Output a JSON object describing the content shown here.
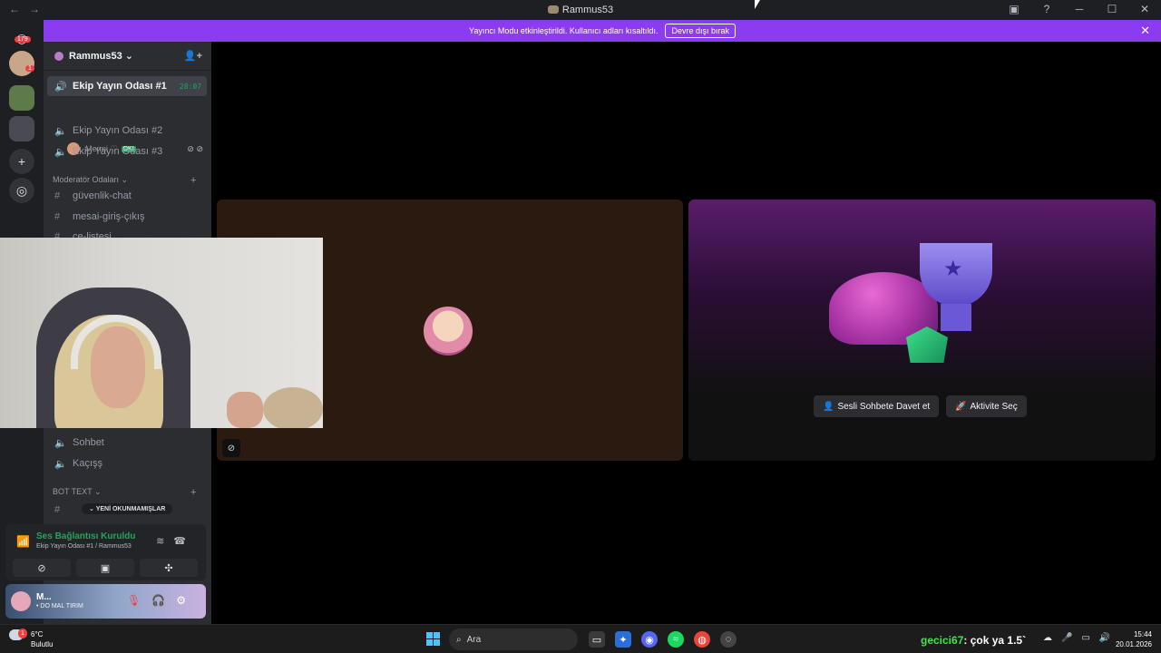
{
  "window": {
    "title": "Rammus53",
    "nav_back": "←",
    "nav_fwd": "→",
    "inbox_icon": "▣",
    "help_icon": "?",
    "min": "─",
    "max": "☐",
    "close": "✕"
  },
  "banner": {
    "text": "Yayıncı Modu etkinleştirildi. Kullanıcı adları kısaltıldı.",
    "button": "Devre dışı bırak",
    "close": "✕"
  },
  "guilds": {
    "badge_top": "179",
    "badge_user": "1"
  },
  "server": {
    "name": "Rammus53",
    "chevron": "⌄",
    "add_icon": "👤+"
  },
  "channels": [
    {
      "name": "Ekip Yayın Odası #1",
      "time": "28:07",
      "active": true
    },
    {
      "name": "Ekip Yayın Odası #2"
    },
    {
      "name": "Ekip Yayın Odası #3"
    }
  ],
  "member": {
    "name": "Mermi ♡",
    "ok": "OK!"
  },
  "categories": {
    "mod": "Moderatör Odaları",
    "bot": "BOT TEXT"
  },
  "text_channels": {
    "guvenlik": "güvenlik-chat",
    "mesai": "mesai-giriş-çıkış",
    "partial": "ce-listesi"
  },
  "voice_more": {
    "sohbet": "Sohbet",
    "kacis": "Kaçışş"
  },
  "new_unread": "YENİ OKUNMAMIŞLAR",
  "voice_panel": {
    "title": "Ses Bağlantısı Kuruldu",
    "subtitle": "Ekip Yayın Odası #1 / Rammus53"
  },
  "user_panel": {
    "name": "M...",
    "status": "• DO MAL TIRIM"
  },
  "activity": {
    "invite": "Sesli Sohbete Davet et",
    "choose": "Aktivite Seç"
  },
  "taskbar": {
    "temp": "6°C",
    "weather": "Bulutlu",
    "search": "Ara",
    "chat_user": "gecici67",
    "chat_msg": ": çok ya 1.5`",
    "time": "15:44",
    "date": "20.01.2026",
    "weather_badge": "1"
  }
}
